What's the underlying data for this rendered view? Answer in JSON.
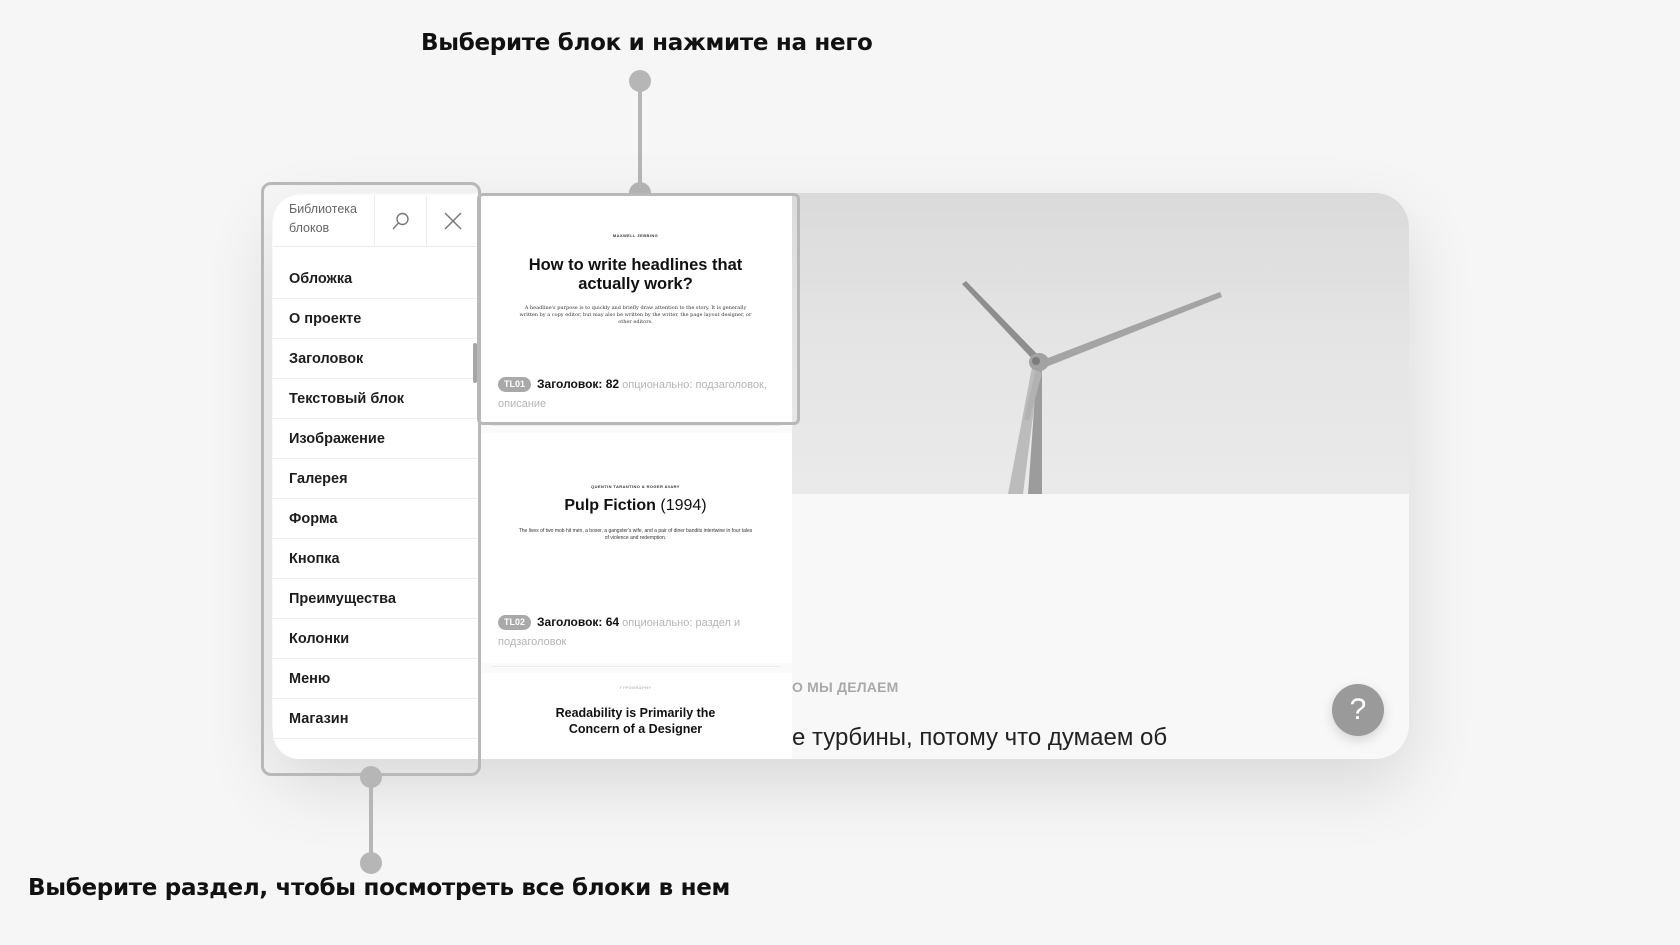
{
  "annotations": {
    "top": "Выберите блок и нажмите на него",
    "bottom": "Выберите раздел, чтобы посмотреть все блоки в нем"
  },
  "sidebar": {
    "title": "Библиотека блоков",
    "search_icon": "search-icon",
    "close_icon": "close-icon",
    "categories": [
      "Обложка",
      "О проекте",
      "Заголовок",
      "Текстовый блок",
      "Изображение",
      "Галерея",
      "Форма",
      "Кнопка",
      "Преимущества",
      "Колонки",
      "Меню",
      "Магазин"
    ],
    "selected": "Заголовок"
  },
  "blocks": [
    {
      "kicker": "MAXWELL ZEBBING",
      "headline": "How to write headlines that actually work?",
      "description": "A headline's purpose is to quickly and briefly draw attention to the story. It is generally written by a copy editor, but may also be written by the writer, the page layout designer, or other editors.",
      "code": "TL01",
      "count_label": "Заголовок: 82",
      "meta": "опционально: подзаголовок, описание"
    },
    {
      "kicker": "QUENTIN TARANTINO & ROGER AVARY",
      "headline": "Pulp Fiction",
      "headline_year": "(1994)",
      "description": "The lives of two mob hit men, a boxer, a gangster's wife, and a pair of diner bandits intertwine in four tales of violence and redemption.",
      "code": "TL02",
      "count_label": "Заголовок: 64",
      "meta": "опционально: раздел и подзаголовок"
    },
    {
      "kicker": "TYPOGRAPHY",
      "headline": "Readability is Primarily the Concern of a Designer"
    }
  ],
  "site": {
    "section_label": "О МЫ ДЕЛАЕМ",
    "section_text": "е турбины, потому что думаем об",
    "help_label": "?"
  },
  "colors": {
    "background": "#f6f6f6",
    "frame": "#b8b8b8",
    "code_badge": "#a9a9a9"
  }
}
